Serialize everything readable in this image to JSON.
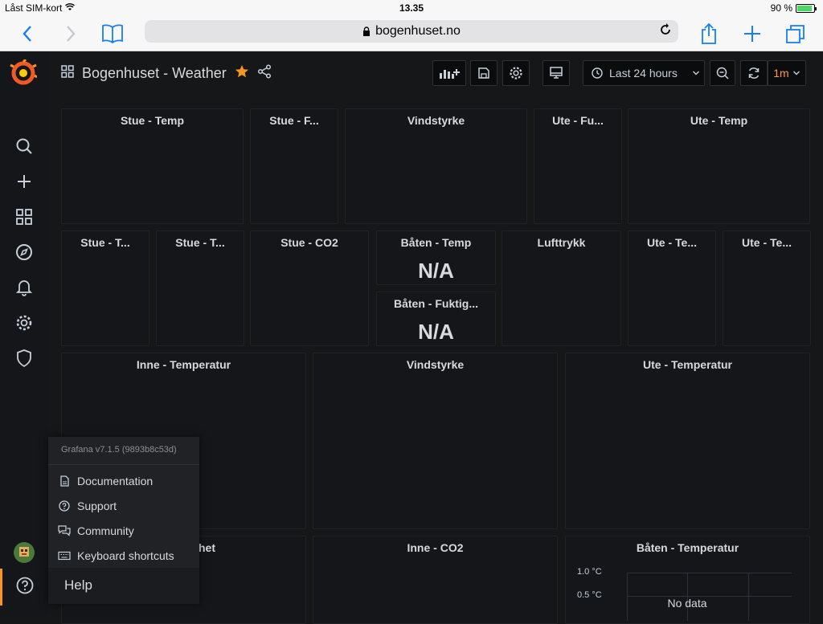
{
  "status": {
    "carrier": "Låst SIM-kort",
    "time": "13.35",
    "battery": "90 %"
  },
  "browser": {
    "url": "bogenhuset.no"
  },
  "dashboard": {
    "title": "Bogenhuset - Weather",
    "time_range": "Last 24 hours",
    "refresh": "1m"
  },
  "panels": {
    "r1": [
      "Stue - Temp",
      "Stue - F...",
      "Vindstyrke",
      "Ute - Fu...",
      "Ute - Temp"
    ],
    "r2": [
      "Stue - T...",
      "Stue - T...",
      "Stue - CO2",
      "Båten - Temp",
      "Båten - Fuktig...",
      "Lufttrykk",
      "Ute - Te...",
      "Ute - Te..."
    ],
    "r2_values": {
      "baten_temp": "N/A",
      "baten_fukt": "N/A"
    },
    "r3": [
      "Inne - Temperatur",
      "Vindstyrke",
      "Ute - Temperatur"
    ],
    "r4": [
      "het",
      "Inne - CO2",
      "Båten - Temperatur"
    ],
    "baten_chart": {
      "y_ticks": [
        "1.0 °C",
        "0.5 °C"
      ],
      "no_data": "No data"
    }
  },
  "help": {
    "version": "Grafana v7.1.5 (9893b8c53d)",
    "items": [
      "Documentation",
      "Support",
      "Community",
      "Keyboard shortcuts"
    ],
    "footer": "Help"
  },
  "colors": {
    "accent": "#f7941e",
    "star": "#f79520",
    "refresh": "#ff9830"
  }
}
